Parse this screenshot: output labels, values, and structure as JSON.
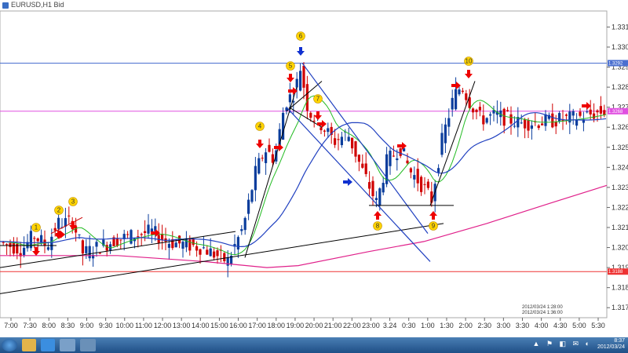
{
  "window": {
    "title": "EURUSD,H1 Bid"
  },
  "chart_data": {
    "type": "candlestick",
    "title": "",
    "y_ticks": [
      "1.3310",
      "1.3300",
      "1.3290",
      "1.3280",
      "1.3270",
      "1.3260",
      "1.3250",
      "1.3240",
      "1.3230",
      "1.3220",
      "1.3210",
      "1.3200",
      "1.3190",
      "1.3180",
      "1.3170"
    ],
    "x_ticks": [
      "7:00",
      "7:30",
      "8:00",
      "8:30",
      "9:00",
      "9:30",
      "10:00",
      "11:00",
      "12:00",
      "13:00",
      "14:00",
      "15:00",
      "16:00",
      "17:00",
      "18:00",
      "19:00",
      "20:00",
      "21:00",
      "22:00",
      "23:00",
      "3.24",
      "0:30",
      "1:00",
      "1:30",
      "2:00",
      "2:30",
      "3:00",
      "3:30",
      "4:00",
      "4:30",
      "5:00",
      "5:30"
    ],
    "ylim": [
      1.3165,
      1.3318
    ],
    "horizontal_levels": [
      {
        "value": 1.3292,
        "color": "#4a6fd0",
        "tag": "1.3292"
      },
      {
        "value": 1.3268,
        "color": "#e050e0",
        "tag": "1.3268"
      },
      {
        "value": 1.3188,
        "color": "#e33",
        "tag": "1.3188"
      }
    ],
    "series": [
      {
        "name": "",
        "type": "ma",
        "color": "#22bb22"
      },
      {
        "name": "",
        "type": "ma",
        "color": "#2040c0"
      },
      {
        "name": "",
        "type": "ma",
        "color": "#e0208a"
      }
    ],
    "annotations": [
      "1",
      "2",
      "3",
      "4",
      "5",
      "6",
      "7",
      "8",
      "9",
      "10"
    ],
    "timestamp_labels": [
      "2012/03/24 1:28:00",
      "2012/03/24 1:36:00"
    ]
  },
  "taskbar": {
    "time": "8:37",
    "date": "2012/03/24",
    "tray_icons": "▲ ⚑ ◧ ✉ ◐"
  }
}
